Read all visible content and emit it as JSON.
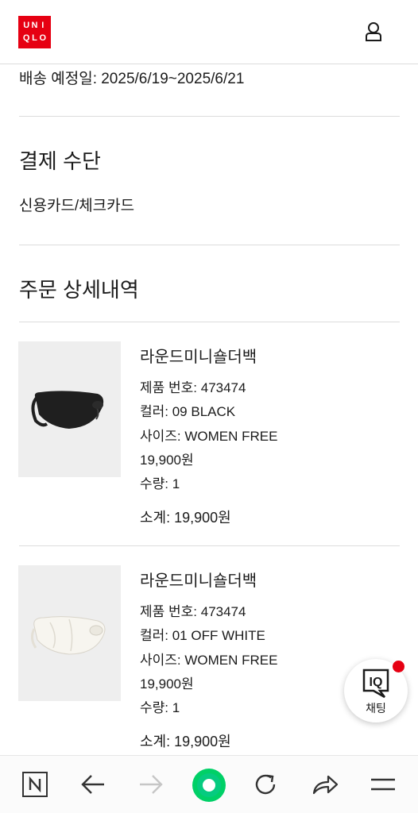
{
  "header": {
    "logo": [
      "U",
      "N",
      "I",
      "Q",
      "L",
      "O"
    ]
  },
  "delivery": {
    "label": "배송 예정일",
    "value": ": 2025/6/19~2025/6/21"
  },
  "payment": {
    "title": "결제 수단",
    "method": "신용카드/체크카드"
  },
  "order": {
    "title": "주문 상세내역",
    "items": [
      {
        "name": "라운드미니숄더백",
        "product_no_label": "제품 번호",
        "product_no": ": 473474",
        "color_label": "컬러",
        "color": ": 09 BLACK",
        "size_label": "사이즈",
        "size": ": WOMEN FREE",
        "price": "19,900원",
        "qty_label": "수량",
        "qty": ": 1",
        "subtotal_label": "소계",
        "subtotal": ": 19,900원",
        "image_color": "#1f1f1f"
      },
      {
        "name": "라운드미니숄더백",
        "product_no_label": "제품 번호",
        "product_no": ": 473474",
        "color_label": "컬러",
        "color": ": 01 OFF WHITE",
        "size_label": "사이즈",
        "size": ": WOMEN FREE",
        "price": "19,900원",
        "qty_label": "수량",
        "qty": ": 1",
        "subtotal_label": "소계",
        "subtotal": ": 19,900원",
        "image_color": "#f2f0ea"
      }
    ]
  },
  "chat": {
    "badge": "IQ",
    "label": "채팅"
  },
  "browser_nav": {
    "icons": [
      "naver-n-icon",
      "back-arrow-icon",
      "forward-arrow-icon",
      "green-home-icon",
      "refresh-icon",
      "share-icon",
      "menu-icon"
    ],
    "accent": "#00c73c"
  },
  "colors": {
    "brand": "#e60012",
    "text": "#1b1b1b",
    "divider": "#dcdcdc"
  }
}
